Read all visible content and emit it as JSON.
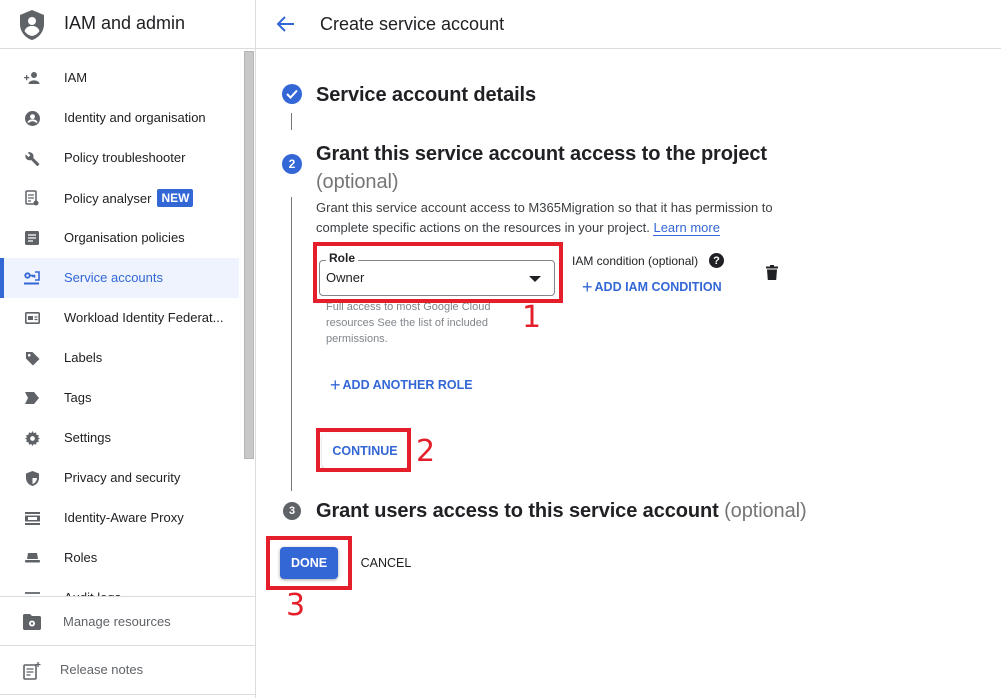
{
  "sidebar": {
    "title": "IAM and admin",
    "logo_icon": "shield-person-icon",
    "items": [
      {
        "label": "IAM",
        "icon": "person-add-icon"
      },
      {
        "label": "Identity and organisation",
        "icon": "account-circle-icon"
      },
      {
        "label": "Policy troubleshooter",
        "icon": "wrench-icon"
      },
      {
        "label": "Policy analyser",
        "icon": "policy-analyser-icon",
        "badge": "NEW"
      },
      {
        "label": "Organisation policies",
        "icon": "article-icon"
      },
      {
        "label": "Service accounts",
        "icon": "service-account-key-icon",
        "active": true
      },
      {
        "label": "Workload Identity Federat...",
        "icon": "id-card-icon"
      },
      {
        "label": "Labels",
        "icon": "label-tag-icon"
      },
      {
        "label": "Tags",
        "icon": "tag-arrow-icon"
      },
      {
        "label": "Settings",
        "icon": "gear-icon"
      },
      {
        "label": "Privacy and security",
        "icon": "security-shield-icon"
      },
      {
        "label": "Identity-Aware Proxy",
        "icon": "proxy-icon"
      },
      {
        "label": "Roles",
        "icon": "hat-icon"
      },
      {
        "label": "Audit logs",
        "icon": "list-icon"
      }
    ],
    "footer": {
      "manage_resources": "Manage resources",
      "release_notes": "Release notes"
    }
  },
  "header": {
    "back_icon": "arrow-back-icon",
    "title": "Create service account"
  },
  "steps": [
    {
      "number": "1",
      "title": "Service account details",
      "state": "completed"
    },
    {
      "number": "2",
      "title": "Grant this service account access to the project",
      "optional": "(optional)",
      "state": "active",
      "description": "Grant this service account access to M365Migration so that it has permission to complete specific actions on the resources in your project.",
      "learn_more": "Learn more"
    },
    {
      "number": "3",
      "title": "Grant users access to this service account",
      "optional": "(optional)",
      "state": "pending"
    }
  ],
  "role_field": {
    "label": "Role",
    "value": "Owner",
    "help": "Full access to most Google Cloud resources See the list of included permissions."
  },
  "iam_condition": {
    "label": "IAM condition (optional)",
    "help_glyph": "?",
    "add_label": "ADD IAM CONDITION"
  },
  "add_role_label": "ADD ANOTHER ROLE",
  "continue_label": "CONTINUE",
  "done_label": "DONE",
  "cancel_label": "CANCEL",
  "annotations": {
    "color": "#e41e2b",
    "labels": [
      "1",
      "2",
      "3"
    ]
  },
  "colors": {
    "accent": "#3367d6",
    "active_bg": "#eef3fd",
    "muted": "#757575"
  }
}
